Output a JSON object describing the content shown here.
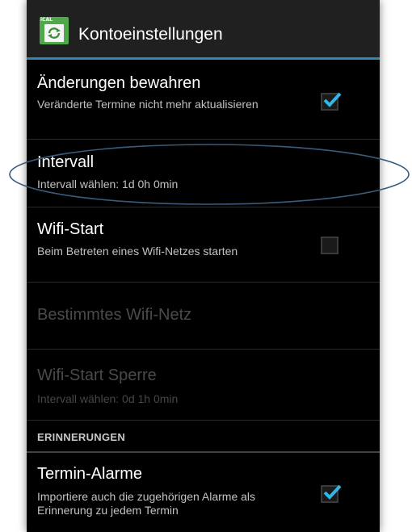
{
  "actionbar": {
    "title": "Kontoeinstellungen",
    "icon_label": "iCAL",
    "accent_color": "#2e8ab5"
  },
  "preferences": [
    {
      "title": "Änderungen bewahren",
      "summary": "Veränderte Termine nicht mehr aktualisieren",
      "checkbox": true,
      "checked": true,
      "enabled": true
    },
    {
      "title": "Intervall",
      "summary": "Intervall wählen: 1d 0h 0min",
      "checkbox": false,
      "enabled": true
    },
    {
      "title": "Wifi-Start",
      "summary": "Beim Betreten eines Wifi-Netzes starten",
      "checkbox": true,
      "checked": false,
      "enabled": true
    },
    {
      "title": "Bestimmtes Wifi-Netz",
      "checkbox": false,
      "enabled": false
    },
    {
      "title": "Wifi-Start Sperre",
      "summary": "Intervall wählen: 0d 1h 0min",
      "checkbox": false,
      "enabled": false
    }
  ],
  "section_header": "ERINNERUNGEN",
  "reminders": [
    {
      "title": "Termin-Alarme",
      "summary": "Importiere auch die zugehörigen Alarme als Erinnerung zu jedem Termin",
      "checkbox": true,
      "checked": true,
      "enabled": true
    }
  ],
  "highlight": {
    "target": "Intervall",
    "color": "#3a5c7a"
  },
  "check_color": "#33b5e5"
}
